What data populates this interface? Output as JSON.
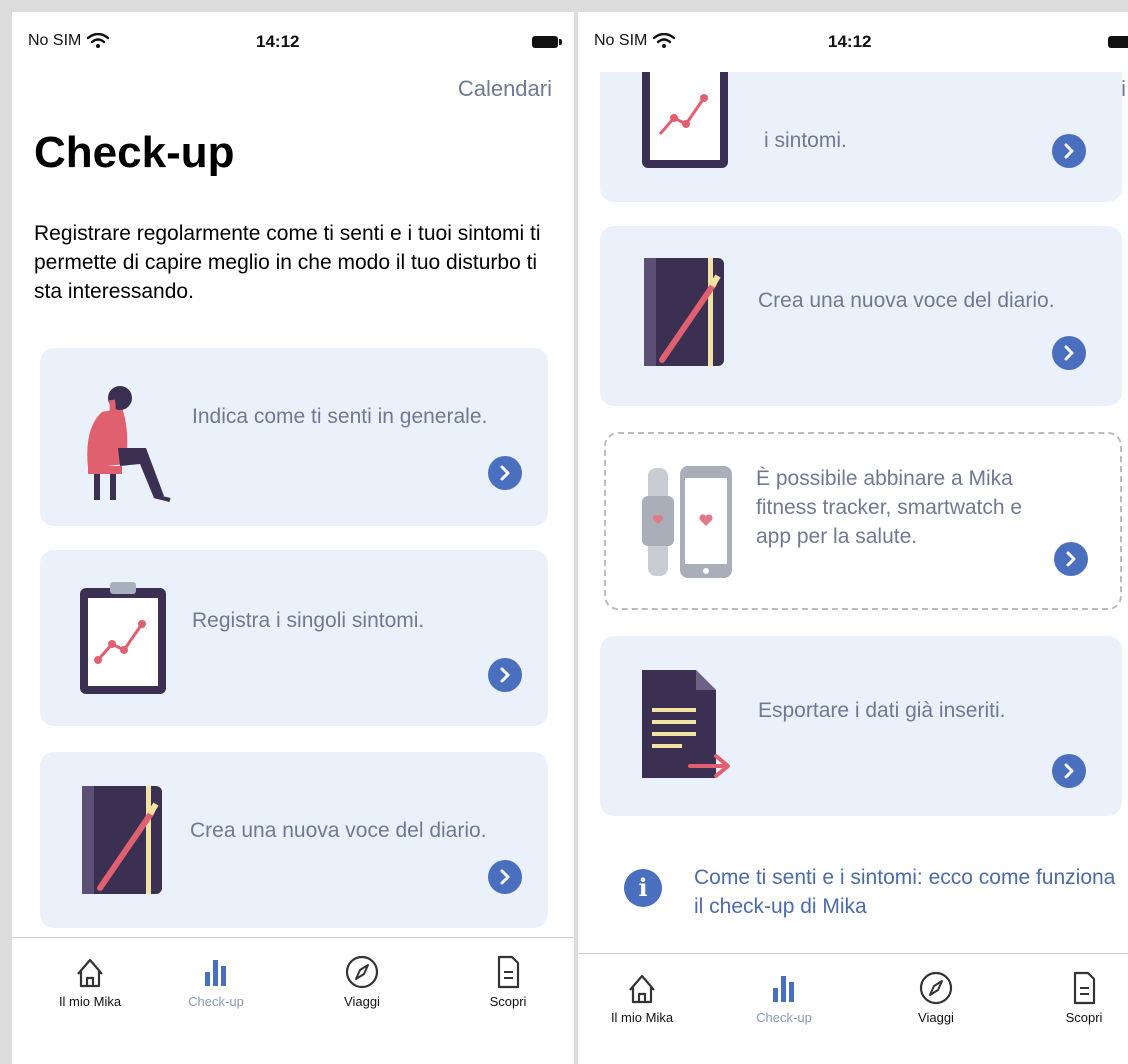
{
  "status_bar": {
    "carrier": "No SIM",
    "time": "14:12"
  },
  "top_action": "Calendari",
  "page_title": "Check-up",
  "intro": "Registrare regolarmente come ti senti e i tuoi sintomi ti permette di capire meglio in che modo il tuo disturbo ti sta interessando.",
  "left_cards": [
    {
      "text": "Indica come ti senti in generale."
    },
    {
      "text": "Registra i singoli sintomi."
    },
    {
      "text": "Crea una nuova voce del diario."
    }
  ],
  "right_cards": [
    {
      "text": "i sintomi."
    },
    {
      "text": "Crea una nuova voce del diario."
    },
    {
      "text": "È possibile abbinare a Mika fitness tracker, smartwatch e app per la salute."
    },
    {
      "text": "Esportare i dati già inseriti."
    }
  ],
  "info_link": {
    "icon": "i",
    "text": "Come ti senti e i sintomi: ecco come funziona il check-up di Mika"
  },
  "tabs": [
    {
      "label": "Il mio Mika",
      "icon": "home-icon"
    },
    {
      "label": "Check-up",
      "icon": "bar-chart-icon",
      "active": true
    },
    {
      "label": "Viaggi",
      "icon": "compass-icon"
    },
    {
      "label": "Scopri",
      "icon": "document-icon"
    }
  ],
  "colors": {
    "accent": "#4a6fbf",
    "card_bg": "#eaf1fb",
    "muted_text": "#6f7a92",
    "illustration_dark": "#3b3052",
    "illustration_pink": "#e06070"
  }
}
